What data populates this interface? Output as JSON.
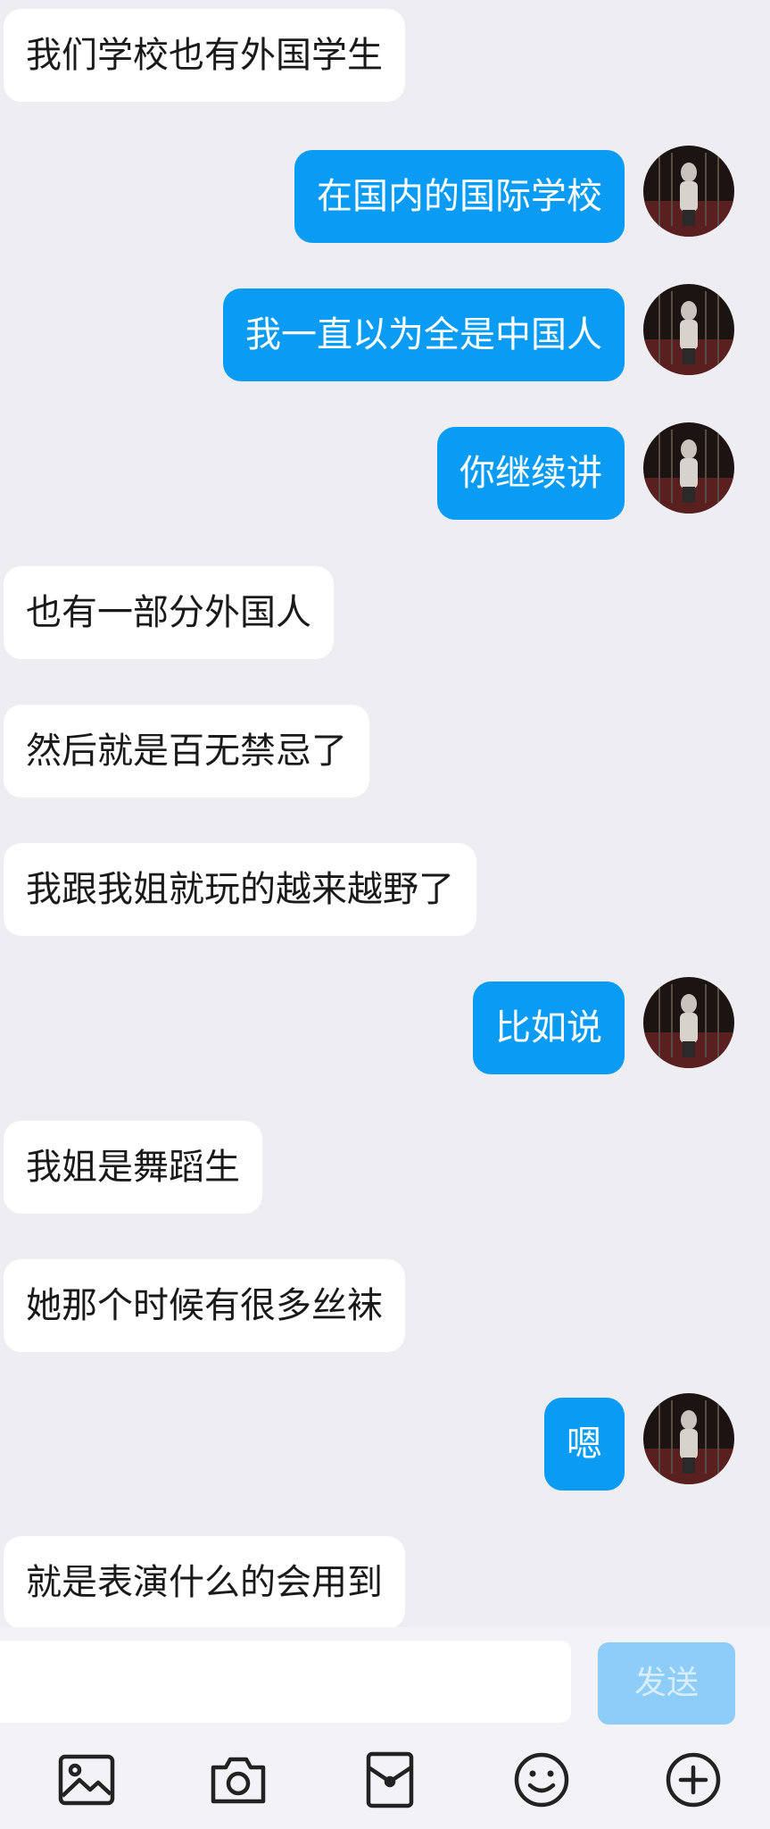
{
  "messages": [
    {
      "side": "in",
      "text": "我们学校也有外国学生"
    },
    {
      "side": "out",
      "text": "在国内的国际学校"
    },
    {
      "side": "out",
      "text": "我一直以为全是中国人"
    },
    {
      "side": "out",
      "text": "你继续讲"
    },
    {
      "side": "in",
      "text": "也有一部分外国人"
    },
    {
      "side": "in",
      "text": "然后就是百无禁忌了"
    },
    {
      "side": "in",
      "text": "我跟我姐就玩的越来越野了"
    },
    {
      "side": "out",
      "text": "比如说"
    },
    {
      "side": "in",
      "text": "我姐是舞蹈生"
    },
    {
      "side": "in",
      "text": "她那个时候有很多丝袜"
    },
    {
      "side": "out",
      "text": "嗯"
    },
    {
      "side": "in",
      "text": "就是表演什么的会用到"
    }
  ],
  "composer": {
    "input_value": "",
    "send_label": "发送"
  },
  "toolbar": [
    "image-icon",
    "camera-icon",
    "red-packet-icon",
    "emoji-icon",
    "plus-icon"
  ],
  "colors": {
    "background": "#ededf2",
    "incoming_bubble": "#ffffff",
    "outgoing_bubble": "#0a9cf5",
    "send_button_disabled": "#8fcdf9"
  }
}
